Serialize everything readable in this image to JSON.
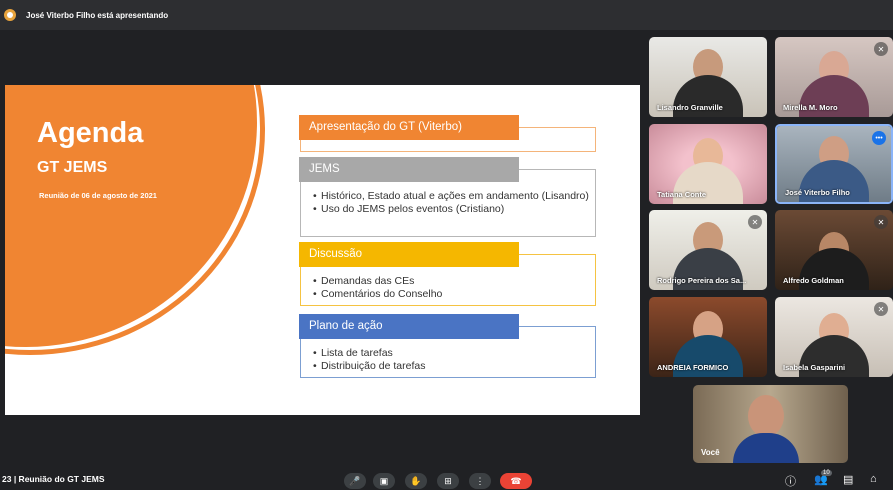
{
  "presenter_bar": {
    "text": "José Viterbo Filho está apresentando"
  },
  "slide": {
    "title": "Agenda",
    "subtitle": "GT JEMS",
    "date": "Reunião de 06 de agosto de 2021",
    "sections": [
      {
        "header": "Apresentação do GT (Viterbo)",
        "items": []
      },
      {
        "header": "JEMS",
        "items": [
          "Histórico, Estado atual e ações em andamento (Lisandro)",
          "Uso do JEMS pelos eventos (Cristiano)"
        ]
      },
      {
        "header": "Discussão",
        "items": [
          "Demandas das CEs",
          "Comentários do Conselho"
        ]
      },
      {
        "header": "Plano de ação",
        "items": [
          "Lista de tarefas",
          "Distribuição de tarefas"
        ]
      }
    ]
  },
  "participants": [
    {
      "name": "Lisandro Granville",
      "muted": false
    },
    {
      "name": "Mirella M. Moro",
      "muted": true
    },
    {
      "name": "Tatiana Conte",
      "muted": false
    },
    {
      "name": "José Viterbo Filho",
      "muted": false,
      "presenting": true
    },
    {
      "name": "Rodrigo Pereira dos Sa...",
      "muted": true
    },
    {
      "name": "Alfredo Goldman",
      "muted": true
    },
    {
      "name": "ANDREIA FORMICO",
      "muted": false
    },
    {
      "name": "Isabela Gasparini",
      "muted": true
    }
  ],
  "self_tile": {
    "name": "Você"
  },
  "bottom_bar": {
    "meeting_title": "23 | Reunião do GT JEMS",
    "controls": [
      "mic-icon",
      "camera-icon",
      "raise-hand-icon",
      "present-icon",
      "more-icon",
      "end-call-icon"
    ],
    "people_count": "10"
  }
}
